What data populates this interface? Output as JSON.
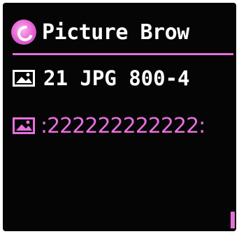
{
  "header": {
    "title": "Picture Brow",
    "icon": "picture-app-icon"
  },
  "list": {
    "items": [
      {
        "label": "21 JPG 800-4",
        "icon": "image-file-icon",
        "selected": false
      },
      {
        "label": ":222222222222:",
        "icon": "image-file-icon",
        "selected": true
      }
    ]
  },
  "colors": {
    "background": "#050505",
    "accent": "#e56fd6",
    "text": "#ffffff"
  }
}
